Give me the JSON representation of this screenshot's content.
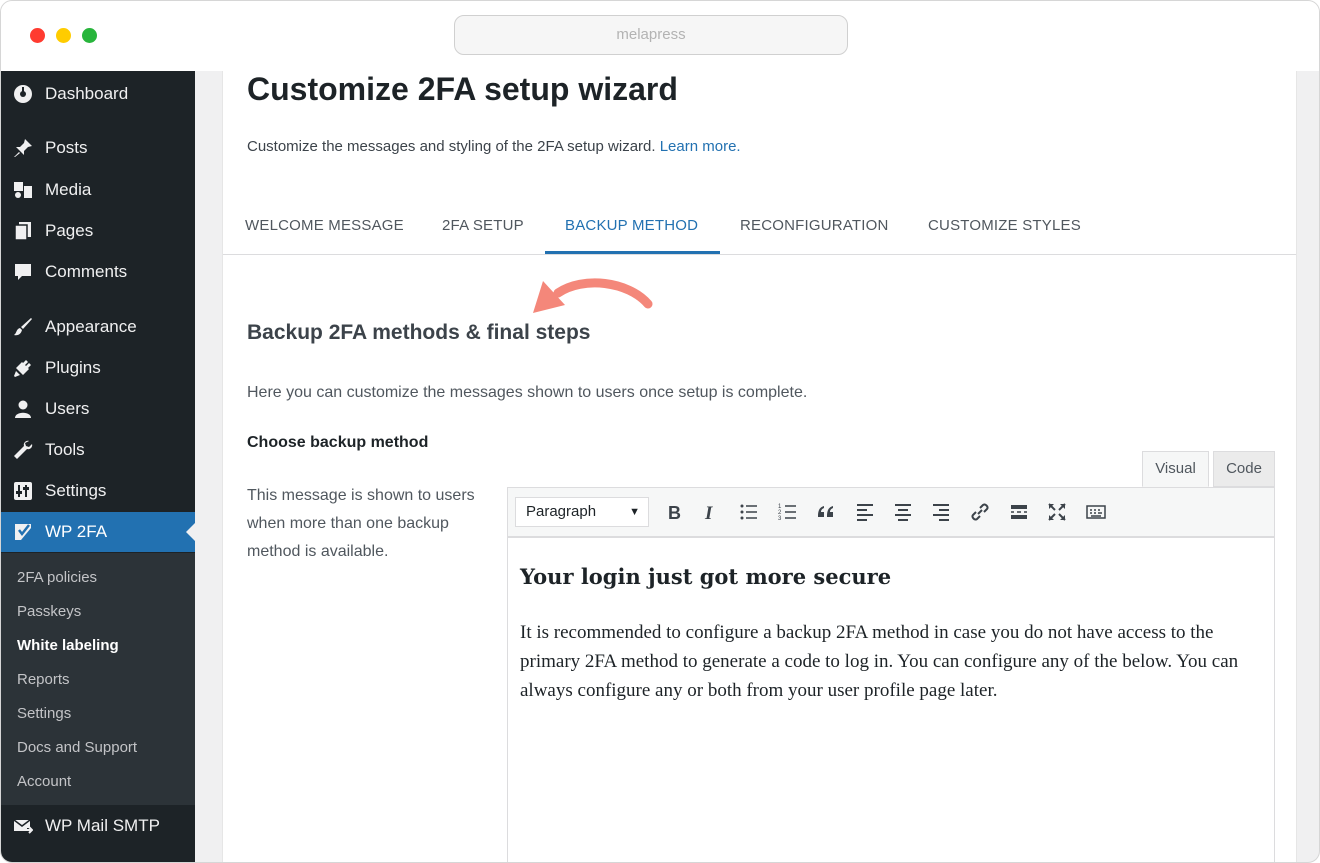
{
  "browser": {
    "url": "melapress"
  },
  "sidebar": {
    "items": [
      {
        "label": "Dashboard",
        "icon": "dashboard-icon"
      },
      {
        "label": "Posts",
        "icon": "pin-icon"
      },
      {
        "label": "Media",
        "icon": "media-icon"
      },
      {
        "label": "Pages",
        "icon": "pages-icon"
      },
      {
        "label": "Comments",
        "icon": "comments-icon"
      },
      {
        "label": "Appearance",
        "icon": "brush-icon"
      },
      {
        "label": "Plugins",
        "icon": "plug-icon"
      },
      {
        "label": "Users",
        "icon": "user-icon"
      },
      {
        "label": "Tools",
        "icon": "wrench-icon"
      },
      {
        "label": "Settings",
        "icon": "settings-icon"
      },
      {
        "label": "WP 2FA",
        "icon": "wp2fa-icon"
      },
      {
        "label": "WP Mail SMTP",
        "icon": "mail-icon"
      }
    ],
    "submenu": [
      "2FA policies",
      "Passkeys",
      "White labeling",
      "Reports",
      "Settings",
      "Docs and Support",
      "Account"
    ],
    "accent": "#2271b1"
  },
  "page": {
    "title": "Customize 2FA setup wizard",
    "description": "Customize the messages and styling of the 2FA setup wizard.",
    "learn_more": "Learn more."
  },
  "tabs": [
    "WELCOME MESSAGE",
    "2FA SETUP",
    "BACKUP METHOD",
    "RECONFIGURATION",
    "CUSTOMIZE STYLES"
  ],
  "section": {
    "title": "Backup 2FA methods & final steps",
    "description": "Here you can customize the messages shown to users once setup is complete.",
    "field_label": "Choose backup method",
    "field_help": "This message is shown to users when more than one backup method is available."
  },
  "editor": {
    "tab_visual": "Visual",
    "tab_code": "Code",
    "format": "Paragraph",
    "heading": "Your login just got more secure",
    "body": "It is recommended to configure a backup 2FA method in case you do not have access to the primary 2FA method to generate a code to log in. You can configure any of the below. You can always configure any or both from your user profile page later."
  },
  "colors": {
    "arrow": "#f4877a",
    "sidebar_bg": "#1d2327"
  }
}
